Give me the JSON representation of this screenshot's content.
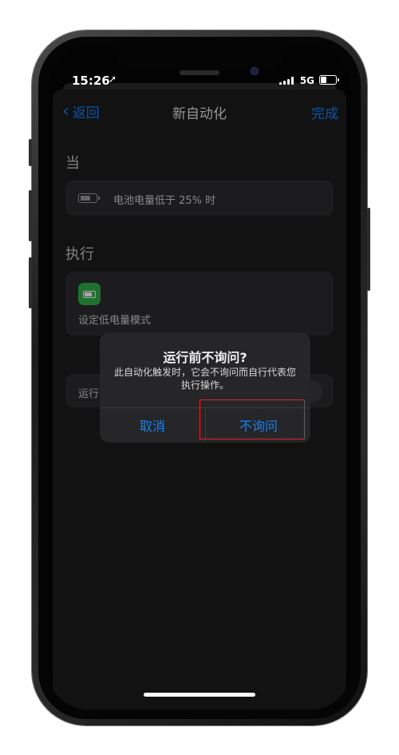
{
  "status_bar": {
    "time": "15:26",
    "location_glyph": "➚",
    "network": "5G",
    "battery_level": 0.35
  },
  "nav": {
    "back_label": "返回",
    "title": "新自动化",
    "done_label": "完成"
  },
  "when": {
    "section_label": "当",
    "trigger": "电池电量低于 25% 时"
  },
  "do": {
    "section_label": "执行",
    "action": "设定低电量模式"
  },
  "ask_before": {
    "label": "运行",
    "enabled": false
  },
  "alert": {
    "title": "运行前不询问?",
    "message": "此自动化触发时，它会不询问而自行代表您执行操作。",
    "cancel_label": "取消",
    "confirm_label": "不询问"
  },
  "colors": {
    "accent": "#0a84ff",
    "highlight": "#e0262a",
    "app_icon": "#2fae48"
  }
}
